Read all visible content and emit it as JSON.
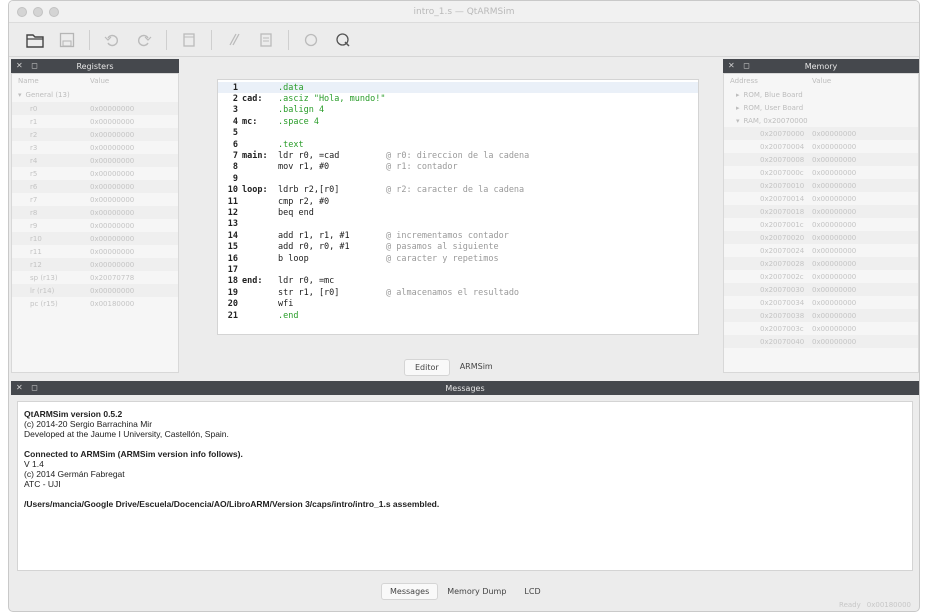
{
  "window": {
    "title": "intro_1.s — QtARMSim"
  },
  "toolbar": {
    "icons": [
      "folder-open-icon",
      "save-icon",
      "undo-icon",
      "redo-icon",
      "document-icon",
      "assemble-icon",
      "list-icon",
      "refresh-icon",
      "run-icon"
    ]
  },
  "registers": {
    "title": "Registers",
    "col_name": "Name",
    "col_value": "Value",
    "group": "General (13)",
    "rows": [
      {
        "name": "r0",
        "value": "0x00000000"
      },
      {
        "name": "r1",
        "value": "0x00000000"
      },
      {
        "name": "r2",
        "value": "0x00000000"
      },
      {
        "name": "r3",
        "value": "0x00000000"
      },
      {
        "name": "r4",
        "value": "0x00000000"
      },
      {
        "name": "r5",
        "value": "0x00000000"
      },
      {
        "name": "r6",
        "value": "0x00000000"
      },
      {
        "name": "r7",
        "value": "0x00000000"
      },
      {
        "name": "r8",
        "value": "0x00000000"
      },
      {
        "name": "r9",
        "value": "0x00000000"
      },
      {
        "name": "r10",
        "value": "0x00000000"
      },
      {
        "name": "r11",
        "value": "0x00000000"
      },
      {
        "name": "r12",
        "value": "0x00000000"
      },
      {
        "name": "sp (r13)",
        "value": "0x20070778"
      },
      {
        "name": "lr (r14)",
        "value": "0x00000000"
      },
      {
        "name": "pc (r15)",
        "value": "0x00180000"
      }
    ]
  },
  "memory": {
    "title": "Memory",
    "col_addr": "Address",
    "col_value": "Value",
    "groups": [
      "ROM, Blue Board",
      "ROM, User Board",
      "RAM, 0x20070000"
    ],
    "rows": [
      {
        "addr": "0x20070000",
        "value": "0x00000000"
      },
      {
        "addr": "0x20070004",
        "value": "0x00000000"
      },
      {
        "addr": "0x20070008",
        "value": "0x00000000"
      },
      {
        "addr": "0x2007000c",
        "value": "0x00000000"
      },
      {
        "addr": "0x20070010",
        "value": "0x00000000"
      },
      {
        "addr": "0x20070014",
        "value": "0x00000000"
      },
      {
        "addr": "0x20070018",
        "value": "0x00000000"
      },
      {
        "addr": "0x2007001c",
        "value": "0x00000000"
      },
      {
        "addr": "0x20070020",
        "value": "0x00000000"
      },
      {
        "addr": "0x20070024",
        "value": "0x00000000"
      },
      {
        "addr": "0x20070028",
        "value": "0x00000000"
      },
      {
        "addr": "0x2007002c",
        "value": "0x00000000"
      },
      {
        "addr": "0x20070030",
        "value": "0x00000000"
      },
      {
        "addr": "0x20070034",
        "value": "0x00000000"
      },
      {
        "addr": "0x20070038",
        "value": "0x00000000"
      },
      {
        "addr": "0x2007003c",
        "value": "0x00000000"
      },
      {
        "addr": "0x20070040",
        "value": "0x00000000"
      }
    ]
  },
  "editor": {
    "lines": [
      {
        "n": "1",
        "label": "",
        "ins": ".data",
        "cmt": ""
      },
      {
        "n": "2",
        "label": "cad:",
        "ins": ".asciz \"Hola, mundo!\"",
        "cmt": ""
      },
      {
        "n": "3",
        "label": "",
        "ins": ".balign 4",
        "cmt": ""
      },
      {
        "n": "4",
        "label": "mc:",
        "ins": ".space 4",
        "cmt": ""
      },
      {
        "n": "5",
        "label": "",
        "ins": "",
        "cmt": ""
      },
      {
        "n": "6",
        "label": "",
        "ins": ".text",
        "cmt": ""
      },
      {
        "n": "7",
        "label": "main:",
        "ins": "ldr r0, =cad",
        "cmt": "@ r0: direccion de la cadena"
      },
      {
        "n": "8",
        "label": "",
        "ins": "mov r1, #0",
        "cmt": "@ r1: contador"
      },
      {
        "n": "9",
        "label": "",
        "ins": "",
        "cmt": ""
      },
      {
        "n": "10",
        "label": "loop:",
        "ins": "ldrb r2,[r0]",
        "cmt": "@ r2: caracter de la cadena"
      },
      {
        "n": "11",
        "label": "",
        "ins": "cmp r2, #0",
        "cmt": ""
      },
      {
        "n": "12",
        "label": "",
        "ins": "beq end",
        "cmt": ""
      },
      {
        "n": "13",
        "label": "",
        "ins": "",
        "cmt": ""
      },
      {
        "n": "14",
        "label": "",
        "ins": "add r1, r1, #1",
        "cmt": "@ incrementamos contador"
      },
      {
        "n": "15",
        "label": "",
        "ins": "add r0, r0, #1",
        "cmt": "@ pasamos al siguiente"
      },
      {
        "n": "16",
        "label": "",
        "ins": "b loop",
        "cmt": "@ caracter y repetimos"
      },
      {
        "n": "17",
        "label": "",
        "ins": "",
        "cmt": ""
      },
      {
        "n": "18",
        "label": "end:",
        "ins": "ldr r0, =mc",
        "cmt": ""
      },
      {
        "n": "19",
        "label": "",
        "ins": "str r1, [r0]",
        "cmt": "@ almacenamos el resultado"
      },
      {
        "n": "20",
        "label": "",
        "ins": "wfi",
        "cmt": ""
      },
      {
        "n": "21",
        "label": "",
        "ins": ".end",
        "cmt": ""
      }
    ]
  },
  "center_tabs": [
    "Editor",
    "ARMSim"
  ],
  "messages": {
    "title": "Messages",
    "lines": [
      {
        "text": "QtARMSim version 0.5.2",
        "bold": true
      },
      {
        "text": "(c) 2014-20 Sergio Barrachina Mir",
        "bold": false
      },
      {
        "text": "Developed at the Jaume I University, Castellón, Spain.",
        "bold": false
      },
      {
        "text": "",
        "bold": false
      },
      {
        "text": "Connected to ARMSim (ARMSim version info follows).",
        "bold": true
      },
      {
        "text": "V 1.4",
        "bold": false
      },
      {
        "text": "(c) 2014 Germán Fabregat",
        "bold": false
      },
      {
        "text": "ATC - UJI",
        "bold": false
      },
      {
        "text": "",
        "bold": false
      },
      {
        "text": "/Users/mancia/Google Drive/Escuela/Docencia/AO/LibroARM/Version 3/caps/intro/intro_1.s assembled.",
        "bold": true
      }
    ]
  },
  "bottom_tabs": [
    "Messages",
    "Memory Dump",
    "LCD"
  ],
  "status": {
    "left": "Ready",
    "right": "0x00180000"
  }
}
